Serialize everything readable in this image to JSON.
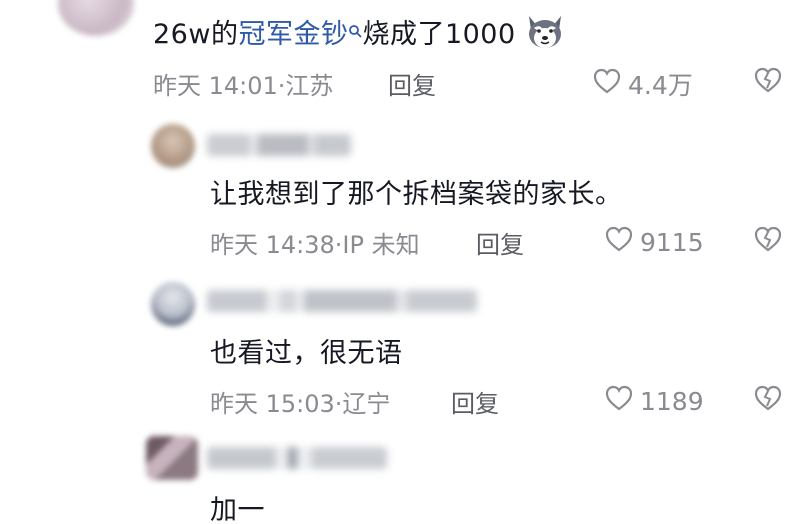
{
  "comments": [
    {
      "text_pre": "26w的",
      "keyword": "冠军金钞",
      "text_post": "烧成了1000",
      "emoji_icon": "husky-dog-icon",
      "meta": "昨天 14:01·江苏",
      "reply_label": "回复",
      "likes": "4.4万"
    },
    {
      "text": "让我想到了那个拆档案袋的家长。",
      "meta": "昨天 14:38·IP 未知",
      "reply_label": "回复",
      "likes": "9115"
    },
    {
      "text": "也看过，很无语",
      "meta": "昨天 15:03·辽宁",
      "reply_label": "回复",
      "likes": "1189"
    },
    {
      "text": "加一"
    }
  ],
  "colors": {
    "text": "#161823",
    "meta": "#8a8b91",
    "keyword": "#2f5aa8"
  }
}
